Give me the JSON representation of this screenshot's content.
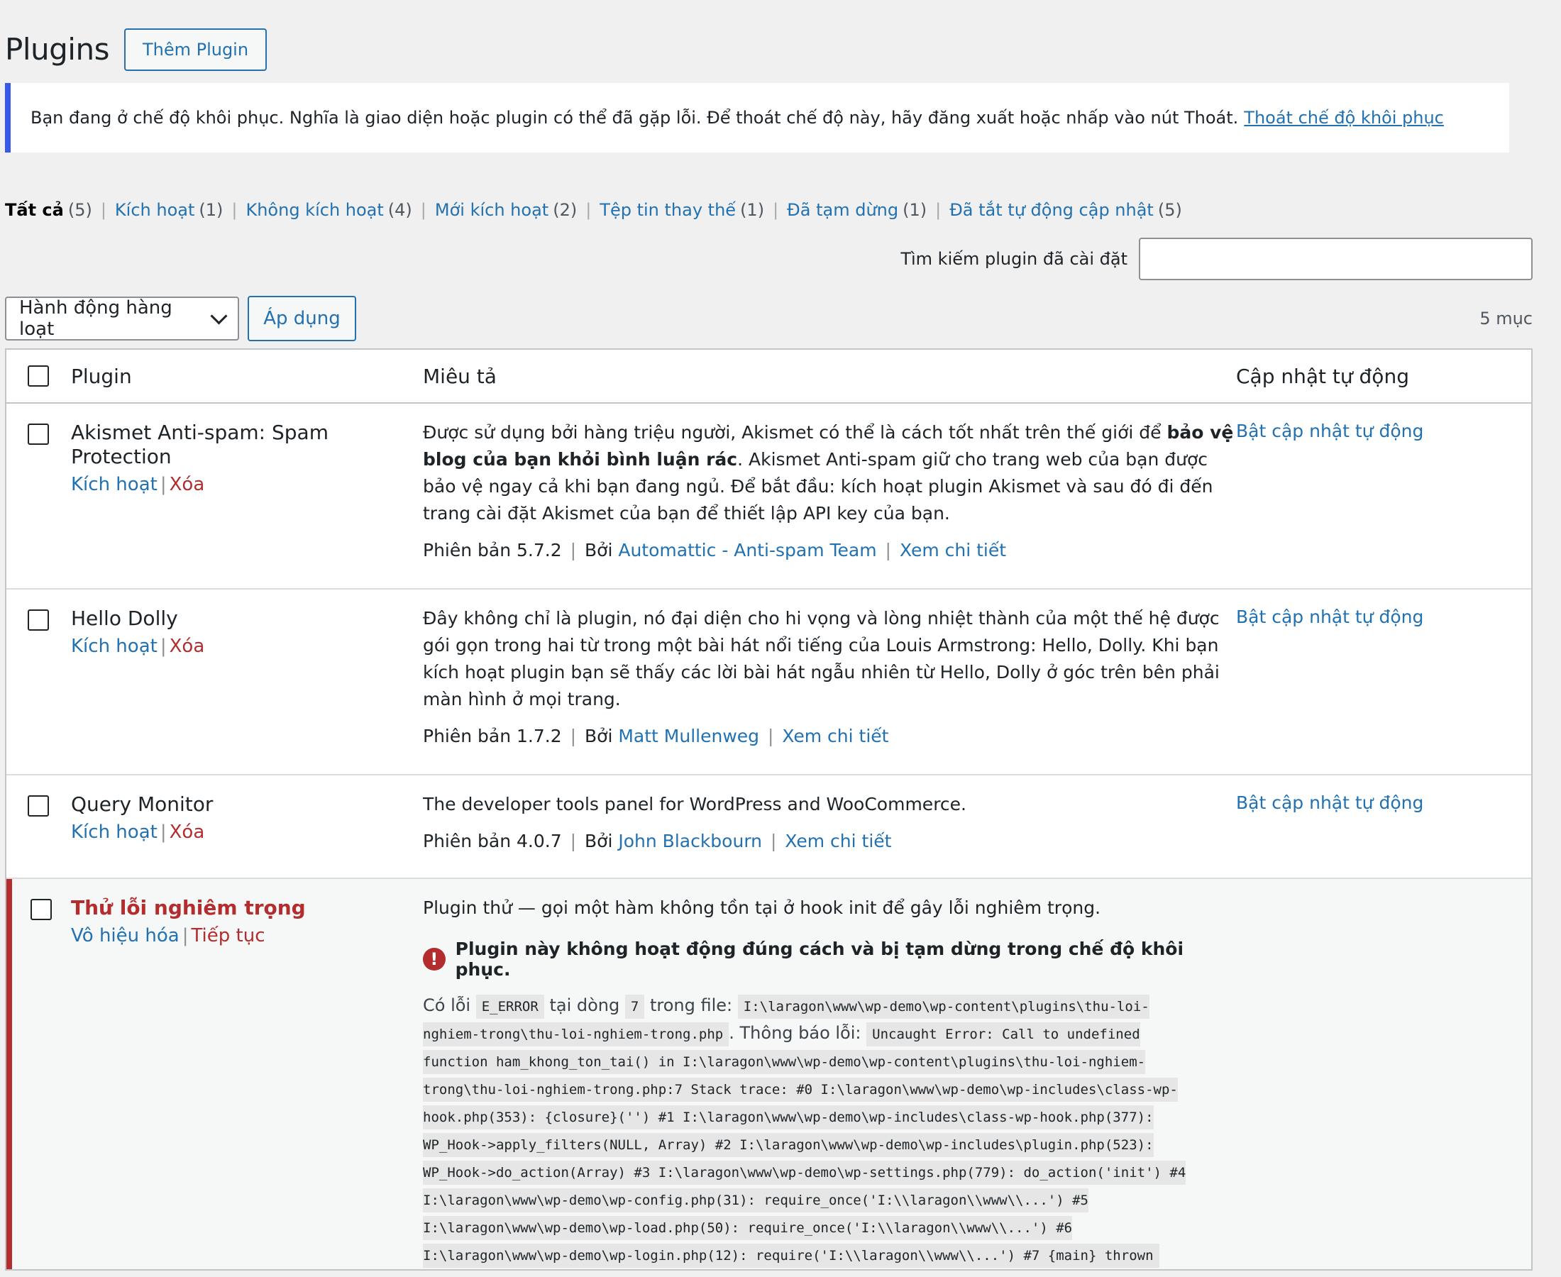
{
  "header": {
    "title": "Plugins",
    "add_button": "Thêm Plugin"
  },
  "notice": {
    "text": "Bạn đang ở chế độ khôi phục. Nghĩa là giao diện hoặc plugin có thể đã gặp lỗi. Để thoát chế độ này, hãy đăng xuất hoặc nhấp vào nút Thoát.",
    "link": "Thoát chế độ khôi phục",
    "border_color": "#3858e9"
  },
  "filters": [
    {
      "label": "Tất cả",
      "count": "(5)"
    },
    {
      "label": "Kích hoạt",
      "count": "(1)"
    },
    {
      "label": "Không kích hoạt",
      "count": "(4)"
    },
    {
      "label": "Mới kích hoạt",
      "count": "(2)"
    },
    {
      "label": "Tệp tin thay thế",
      "count": "(1)"
    },
    {
      "label": "Đã tạm dừng",
      "count": "(1)"
    },
    {
      "label": "Đã tắt tự động cập nhật",
      "count": "(5)"
    }
  ],
  "search": {
    "label": "Tìm kiếm plugin đã cài đặt",
    "value": ""
  },
  "bulk": {
    "select_label": "Hành động hàng loạt",
    "apply_label": "Áp dụng",
    "items_count": "5 mục"
  },
  "table": {
    "col_plugin": "Plugin",
    "col_desc": "Miêu tả",
    "col_auto": "Cập nhật tự động"
  },
  "common": {
    "activate": "Kích hoạt",
    "delete": "Xóa",
    "version_prefix": "Phiên bản",
    "by": "Bởi",
    "details": "Xem chi tiết",
    "auto_update": "Bật cập nhật tự động",
    "pipe": "|"
  },
  "plugins": [
    {
      "name": "Akismet Anti-spam: Spam Protection",
      "desc_a": "Được sử dụng bởi hàng triệu người, Akismet có thể là cách tốt nhất trên thế giới để ",
      "desc_bold": "bảo vệ blog của bạn khỏi bình luận rác",
      "desc_b": ". Akismet Anti-spam giữ cho trang web của bạn được bảo vệ ngay cả khi bạn đang ngủ. Để bắt đầu: kích hoạt plugin Akismet và sau đó đi đến trang cài đặt Akismet của bạn để thiết lập API key của bạn.",
      "version": "5.7.2",
      "author": "Automattic - Anti-spam Team"
    },
    {
      "name": "Hello Dolly",
      "desc": "Đây không chỉ là plugin, nó đại diện cho hi vọng và lòng nhiệt thành của một thế hệ được gói gọn trong hai từ trong một bài hát nổi tiếng của Louis Armstrong: Hello, Dolly. Khi bạn kích hoạt plugin bạn sẽ thấy các lời bài hát ngẫu nhiên từ Hello, Dolly ở góc trên bên phải màn hình ở mọi trang.",
      "version": "1.7.2",
      "author": "Matt Mullenweg"
    },
    {
      "name": "Query Monitor",
      "desc": "The developer tools panel for WordPress and WooCommerce.",
      "version": "4.0.7",
      "author": "John Blackbourn"
    }
  ],
  "paused_plugin": {
    "name": "Thử lỗi nghiêm trọng",
    "deactivate": "Vô hiệu hóa",
    "resume": "Tiếp tục",
    "desc": "Plugin thử — gọi một hàm không tồn tại ở hook init để gây lỗi nghiêm trọng.",
    "error_heading": "Plugin này không hoạt động đúng cách và bị tạm dừng trong chế độ khôi phục.",
    "error_icon": "!",
    "err_prefix": "Có lỗi",
    "err_code": "E_ERROR",
    "err_line_label": "tại dòng",
    "err_line": "7",
    "err_file_label": "trong file:",
    "err_file": "I:\\laragon\\www\\wp-demo\\wp-content\\plugins\\thu-loi-nghiem-trong\\thu-loi-nghiem-trong.php",
    "err_msg_label": ". Thông báo lỗi:",
    "err_msg": "Uncaught Error: Call to undefined function ham_khong_ton_tai() in I:\\laragon\\www\\wp-demo\\wp-content\\plugins\\thu-loi-nghiem-trong\\thu-loi-nghiem-trong.php:7 Stack trace: #0 I:\\laragon\\www\\wp-demo\\wp-includes\\class-wp-hook.php(353): {closure}('') #1 I:\\laragon\\www\\wp-demo\\wp-includes\\class-wp-hook.php(377): WP_Hook->apply_filters(NULL, Array) #2 I:\\laragon\\www\\wp-demo\\wp-includes\\plugin.php(523): WP_Hook->do_action(Array) #3 I:\\laragon\\www\\wp-demo\\wp-settings.php(779): do_action('init') #4 I:\\laragon\\www\\wp-demo\\wp-config.php(31): require_once('I:\\\\laragon\\\\www\\\\...') #5 I:\\laragon\\www\\wp-demo\\wp-load.php(50): require_once('I:\\\\laragon\\\\www\\\\...') #6 I:\\laragon\\www\\wp-demo\\wp-login.php(12): require('I:\\\\laragon\\\\www\\\\...') #7 {main} thrown"
  },
  "colors": {
    "link": "#2271b1",
    "delete": "#b32d2e",
    "background": "#f0f0f1"
  }
}
